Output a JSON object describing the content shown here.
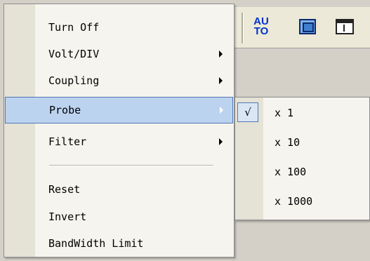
{
  "toolbar": {
    "auto_label_line1": "AU",
    "auto_label_line2": "TO"
  },
  "menu": {
    "items": [
      {
        "label": "Turn Off",
        "has_submenu": false
      },
      {
        "label": "Volt/DIV",
        "has_submenu": true
      },
      {
        "label": "Coupling",
        "has_submenu": true
      },
      {
        "label": "Probe",
        "has_submenu": true,
        "selected": true
      },
      {
        "label": "Filter",
        "has_submenu": true
      },
      {
        "label": "Reset",
        "has_submenu": false
      },
      {
        "label": "Invert",
        "has_submenu": false
      },
      {
        "label": "BandWidth Limit",
        "has_submenu": false
      }
    ]
  },
  "submenu": {
    "check_mark": "√",
    "items": [
      {
        "label": "x 1",
        "checked": true
      },
      {
        "label": "x 10",
        "checked": false
      },
      {
        "label": "x 100",
        "checked": false
      },
      {
        "label": "x 1000",
        "checked": false
      }
    ]
  },
  "colors": {
    "selection_fill": "#bcd3f0",
    "selection_border": "#4e77b5",
    "menu_background": "#f5f4ee",
    "gutter": "#e5e2d6"
  },
  "icons": [
    "auto-scale-icon",
    "fit-window-icon",
    "panel-toggle-icon",
    "submenu-arrow-icon",
    "check-icon"
  ]
}
